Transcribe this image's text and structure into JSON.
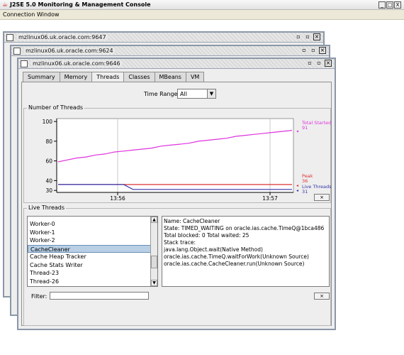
{
  "app": {
    "title": "J2SE 5.0 Monitoring & Management Console",
    "window_controls": [
      "_",
      "□",
      "X"
    ]
  },
  "menu": {
    "items": [
      "Connection",
      "Window"
    ]
  },
  "windows": [
    {
      "title": "mzlinux06.uk.oracle.com:9647"
    },
    {
      "title": "mzlinux06.uk.oracle.com:9624"
    },
    {
      "title": "mzlinux06.uk.oracle.com:9646"
    }
  ],
  "tabs": [
    "Summary",
    "Memory",
    "Threads",
    "Classes",
    "MBeans",
    "VM"
  ],
  "active_tab": "Threads",
  "time_range": {
    "label": "Time Range:",
    "value": "All"
  },
  "threads_panel": {
    "title": "Number of Threads",
    "collapse_label": "⨯"
  },
  "chart_data": {
    "type": "line",
    "y_ticks": [
      30,
      40,
      60,
      80,
      100
    ],
    "ylim": [
      28,
      103
    ],
    "x_ticks": [
      "13:56",
      "13:57"
    ],
    "series": [
      {
        "name": "Total Started",
        "color": "#dd33dd",
        "last_value": "91",
        "values": [
          59,
          61,
          63,
          64,
          66,
          67,
          69,
          70,
          71,
          72,
          73,
          75,
          76,
          77,
          78,
          80,
          81,
          82,
          83,
          85,
          86,
          87,
          88,
          89,
          90,
          91
        ]
      },
      {
        "name": "Peak",
        "color": "#dd3333",
        "last_value": "36",
        "values": [
          36,
          36,
          36,
          36,
          36,
          36,
          36,
          36,
          36,
          36,
          36,
          36,
          36,
          36,
          36,
          36,
          36,
          36,
          36,
          36,
          36,
          36,
          36,
          36,
          36,
          36
        ]
      },
      {
        "name": "Live Threads",
        "color": "#3333aa",
        "last_value": "31",
        "values": [
          36,
          36,
          36,
          36,
          36,
          36,
          36,
          36,
          31,
          31,
          31,
          31,
          31,
          31,
          31,
          31,
          31,
          31,
          31,
          31,
          31,
          31,
          31,
          31,
          31,
          31
        ]
      }
    ]
  },
  "live_threads": {
    "title": "Live Threads",
    "items": [
      "Worker-0",
      "Worker-1",
      "Worker-2",
      "CacheCleaner",
      "Cache Heap Tracker",
      "Cache Stats Writer",
      "Thread-23",
      "Thread-26"
    ],
    "selected": "CacheCleaner",
    "details": [
      "Name: CacheCleaner",
      "State: TIMED_WAITING on oracle.ias.cache.TimeQ@1bca486",
      "Total blocked: 0  Total waited: 25",
      "",
      "Stack trace:",
      "java.lang.Object.wait(Native Method)",
      "oracle.ias.cache.TimeQ.waitForWork(Unknown Source)",
      "oracle.ias.cache.CacheCleaner.run(Unknown Source)"
    ],
    "filter_label": "Filter:",
    "filter_value": "",
    "collapse_label": "⨯"
  }
}
